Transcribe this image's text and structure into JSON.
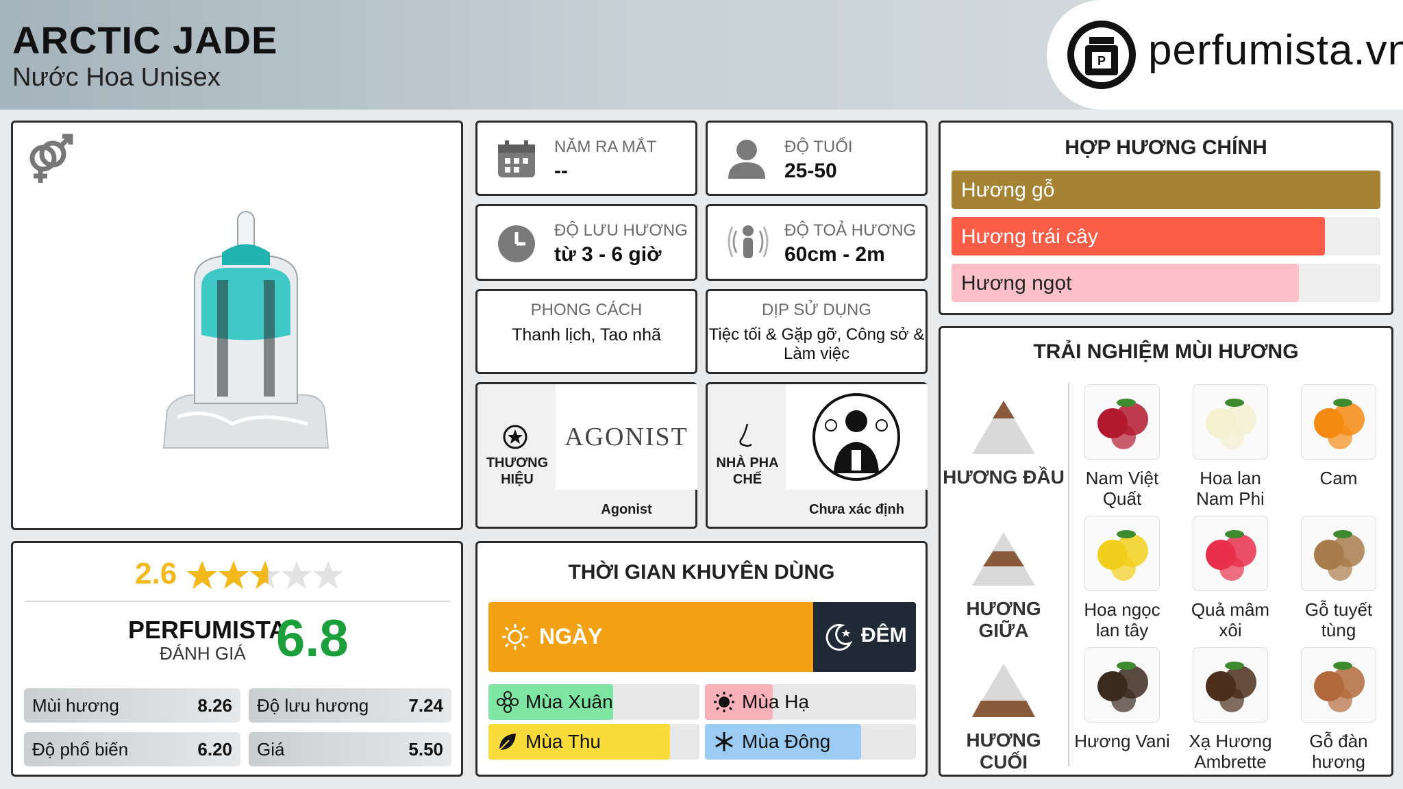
{
  "header": {
    "title": "ARCTIC JADE",
    "subtitle": "Nước Hoa Unisex",
    "logo_text": "perfumista.vn"
  },
  "product": {
    "gender_icon": "unisex-icon",
    "image": "perfume-bottle-image"
  },
  "info": {
    "launch_label": "NĂM RA MẮT",
    "launch_value": "--",
    "age_label": "ĐỘ TUỔI",
    "age_value": "25-50",
    "longevity_label": "ĐỘ LƯU HƯƠNG",
    "longevity_value": "từ 3 - 6 giờ",
    "sillage_label": "ĐỘ TOẢ HƯƠNG",
    "sillage_value": "60cm - 2m",
    "style_label": "PHONG CÁCH",
    "style_value": "Thanh lịch, Tao nhã",
    "occasion_label": "DỊP SỬ DỤNG",
    "occasion_value_1": "Tiệc tối & Gặp gỡ, Công sở &",
    "occasion_value_2": "Làm việc",
    "brand_label_1": "THƯƠNG",
    "brand_label_2": "HIỆU",
    "brand_logo": "AGONIST",
    "brand_name": "Agonist",
    "perfumer_label_1": "NHÀ PHA",
    "perfumer_label_2": "CHẾ",
    "perfumer_name": "Chưa xác định"
  },
  "accords": {
    "title": "HỢP HƯƠNG CHÍNH",
    "items": [
      {
        "label": "Hương gỗ",
        "value": 100,
        "color": "#a68334"
      },
      {
        "label": "Hương trái cây",
        "value": 87,
        "color": "#fb5d47"
      },
      {
        "label": "Hương ngọt",
        "value": 81,
        "color": "#fbc0c8"
      }
    ]
  },
  "notes": {
    "title": "TRẢI NGHIỆM MÙI HƯƠNG",
    "top_label": "HƯƠNG ĐẦU",
    "mid_label": "HƯƠNG GIỮA",
    "base_label": "HƯƠNG CUỐI",
    "top": [
      {
        "n1": "Nam Việt",
        "n2": "Quất",
        "icon": "cranberry-icon",
        "color": "#b3192e"
      },
      {
        "n1": "Hoa lan",
        "n2": "Nam Phi",
        "icon": "freesia-icon",
        "color": "#f4f0d0"
      },
      {
        "n1": "Cam",
        "n2": "",
        "icon": "orange-icon",
        "color": "#f48a12"
      }
    ],
    "mid": [
      {
        "n1": "Hoa ngọc",
        "n2": "lan tây",
        "icon": "ylang-ylang-icon",
        "color": "#f2cf1c"
      },
      {
        "n1": "Quả mâm",
        "n2": "xôi",
        "icon": "raspberry-icon",
        "color": "#e8304c"
      },
      {
        "n1": "Gỗ tuyết",
        "n2": "tùng",
        "icon": "cedar-icon",
        "color": "#a87b4a"
      }
    ],
    "base": [
      {
        "n1": "Hương Vani",
        "n2": "",
        "icon": "vanilla-icon",
        "color": "#3b2a1e"
      },
      {
        "n1": "Xạ Hương",
        "n2": "Ambrette",
        "icon": "ambrette-icon",
        "color": "#4b2e1c"
      },
      {
        "n1": "Gỗ đàn",
        "n2": "hương",
        "icon": "sandalwood-icon",
        "color": "#b26a3c"
      }
    ]
  },
  "rating": {
    "score": "2.6",
    "stars": 2.6,
    "brand": "PERFUMISTA",
    "label": "ĐÁNH GIÁ",
    "total": "6.8",
    "items": [
      {
        "label": "Mùi hương",
        "value": "8.26"
      },
      {
        "label": "Độ lưu hương",
        "value": "7.24"
      },
      {
        "label": "Độ phổ biến",
        "value": "6.20"
      },
      {
        "label": "Giá",
        "value": "5.50"
      }
    ]
  },
  "time": {
    "title": "THỜI GIAN KHUYÊN DÙNG",
    "day_label": "NGÀY",
    "night_label": "ĐÊM",
    "day_share": 0.76,
    "seasons": [
      {
        "label": "Mùa Xuân",
        "value": 0.59,
        "color": "#7ee5a3",
        "icon": "spring-icon"
      },
      {
        "label": "Mùa Hạ",
        "value": 0.32,
        "color": "#f8b1b8",
        "icon": "sun-icon"
      },
      {
        "label": "Mùa Thu",
        "value": 0.86,
        "color": "#f9dc3c",
        "icon": "leaf-icon"
      },
      {
        "label": "Mùa Đông",
        "value": 0.74,
        "color": "#9ccbf3",
        "icon": "snowflake-icon"
      }
    ]
  },
  "colors": {
    "day": "#f3a114",
    "night": "#1f2a36",
    "score_green": "#1b9f3a",
    "star": "#f3b81b"
  }
}
